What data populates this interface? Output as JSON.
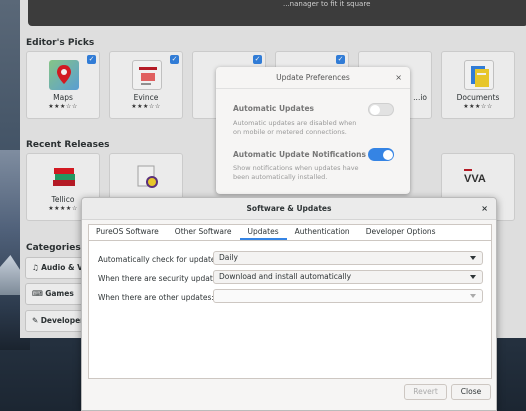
{
  "software_center": {
    "banner_text": "...nanager to fit it square",
    "editors_picks_title": "Editor's Picks",
    "editors_picks": [
      {
        "name": "Maps",
        "stars": "★★★☆☆"
      },
      {
        "name": "Evince",
        "stars": "★★★☆☆"
      },
      {
        "name": "",
        "stars": ""
      },
      {
        "name": "",
        "stars": ""
      },
      {
        "name": "...io",
        "stars": ""
      },
      {
        "name": "Documents",
        "stars": "★★★☆☆"
      }
    ],
    "recent_releases_title": "Recent Releases",
    "recent_releases": [
      {
        "name": "Tellico",
        "stars": "★★★★☆"
      },
      {
        "name": "",
        "stars": ""
      },
      {
        "name": "",
        "stars": ""
      },
      {
        "name": "",
        "stars": ""
      },
      {
        "name": "",
        "stars": ""
      },
      {
        "name": "VVA",
        "stars": ""
      }
    ],
    "categories_title": "Categories",
    "categories": [
      {
        "icon": "music-note-icon",
        "label": "Audio & Vid"
      },
      {
        "icon": "gamepad-icon",
        "label": "Games"
      },
      {
        "icon": "pencil-icon",
        "label": "Developer T"
      }
    ]
  },
  "update_preferences": {
    "title": "Update Preferences",
    "automatic_updates": {
      "label": "Automatic Updates",
      "description": "Automatic updates are disabled when on mobile or metered connections.",
      "enabled": false
    },
    "automatic_notifications": {
      "label": "Automatic Update Notifications",
      "description": "Show notifications when updates have been automatically installed.",
      "enabled": true
    }
  },
  "software_updates": {
    "title": "Software & Updates",
    "tabs": [
      "PureOS Software",
      "Other Software",
      "Updates",
      "Authentication",
      "Developer Options"
    ],
    "active_tab": "Updates",
    "check_label": "Automatically check for updates:",
    "check_value": "Daily",
    "security_label": "When there are security updates:",
    "security_value": "Download and install automatically",
    "other_label": "When there are other updates:",
    "other_value": "",
    "revert_label": "Revert",
    "close_label": "Close"
  },
  "colors": {
    "accent": "#3584e4",
    "window_bg": "#f6f5f4"
  }
}
